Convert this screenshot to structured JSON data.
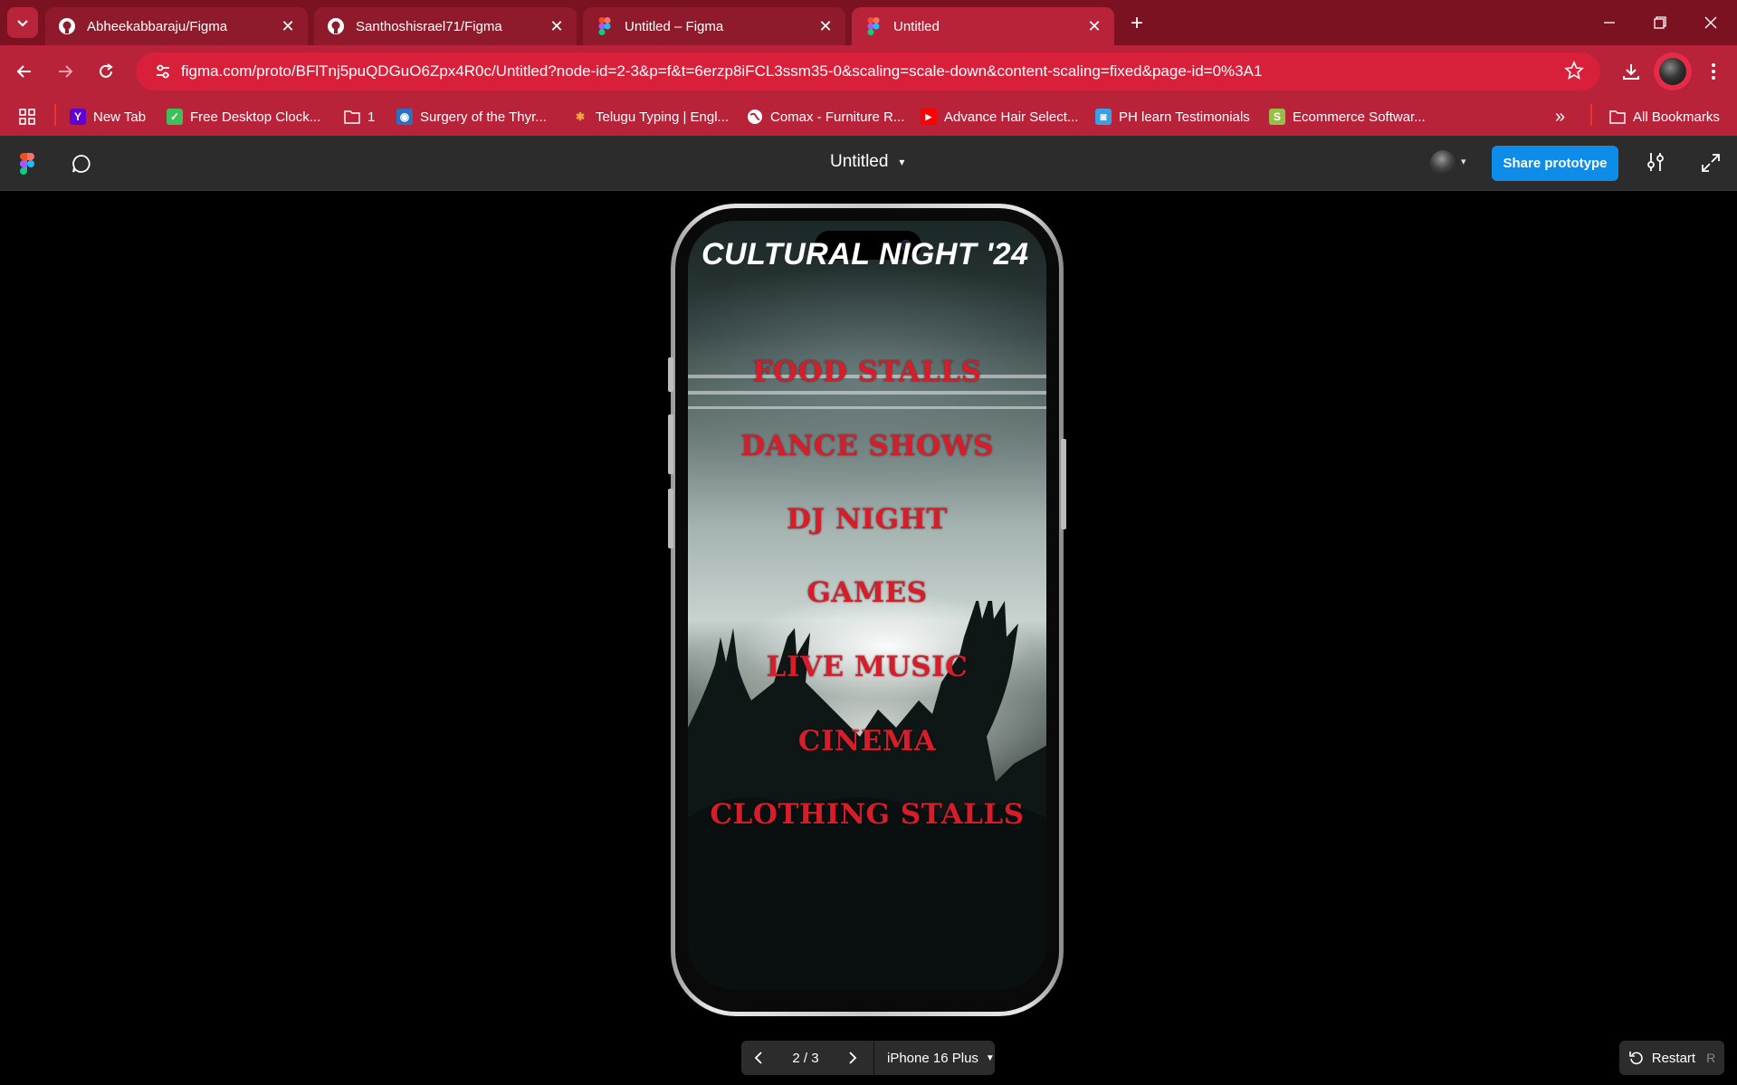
{
  "browser": {
    "tabs": [
      {
        "title": "Abheekabbaraju/Figma",
        "icon": "github-icon",
        "active": false
      },
      {
        "title": "Santhoshisrael71/Figma",
        "icon": "github-icon",
        "active": false
      },
      {
        "title": "Untitled – Figma",
        "icon": "figma-icon",
        "active": false
      },
      {
        "title": "Untitled",
        "icon": "figma-icon",
        "active": true
      }
    ],
    "url": "figma.com/proto/BFlTnj5puQDGuO6Zpx4R0c/Untitled?node-id=2-3&p=f&t=6erzp8iFCL3ssm35-0&scaling=scale-down&content-scaling=fixed&page-id=0%3A1",
    "bookmarks": [
      {
        "label": "New Tab",
        "icon": "yahoo-icon"
      },
      {
        "label": "Free Desktop Clock...",
        "icon": "clock-icon"
      },
      {
        "label": "1",
        "icon": "folder-icon"
      },
      {
        "label": "Surgery of the Thyr...",
        "icon": "globe-icon"
      },
      {
        "label": "Telugu Typing | Engl...",
        "icon": "joomla-icon"
      },
      {
        "label": "Comax - Furniture R...",
        "icon": "globe-icon"
      },
      {
        "label": "Advance Hair Select...",
        "icon": "youtube-icon"
      },
      {
        "label": "PH learn Testimonials",
        "icon": "camera-icon"
      },
      {
        "label": "Ecommerce Softwar...",
        "icon": "shopify-icon"
      }
    ],
    "all_bookmarks": "All Bookmarks",
    "colors": {
      "tabstrip": "#7a1222",
      "toolbar": "#b9233a",
      "omnibox": "#d8203b"
    }
  },
  "figma": {
    "file_title": "Untitled",
    "share_label": "Share prototype",
    "pager": "2 / 3",
    "device": "iPhone 16 Plus",
    "restart_label": "Restart",
    "restart_key": "R",
    "accent": "#0d8ce9"
  },
  "prototype": {
    "title": "CULTURAL NIGHT '24",
    "menu": [
      "FOOD STALLS",
      "DANCE SHOWS",
      "DJ NIGHT",
      "GAMES",
      "LIVE MUSIC",
      "CINEMA",
      "CLOTHING STALLS"
    ],
    "menu_color": "#d71d29"
  }
}
